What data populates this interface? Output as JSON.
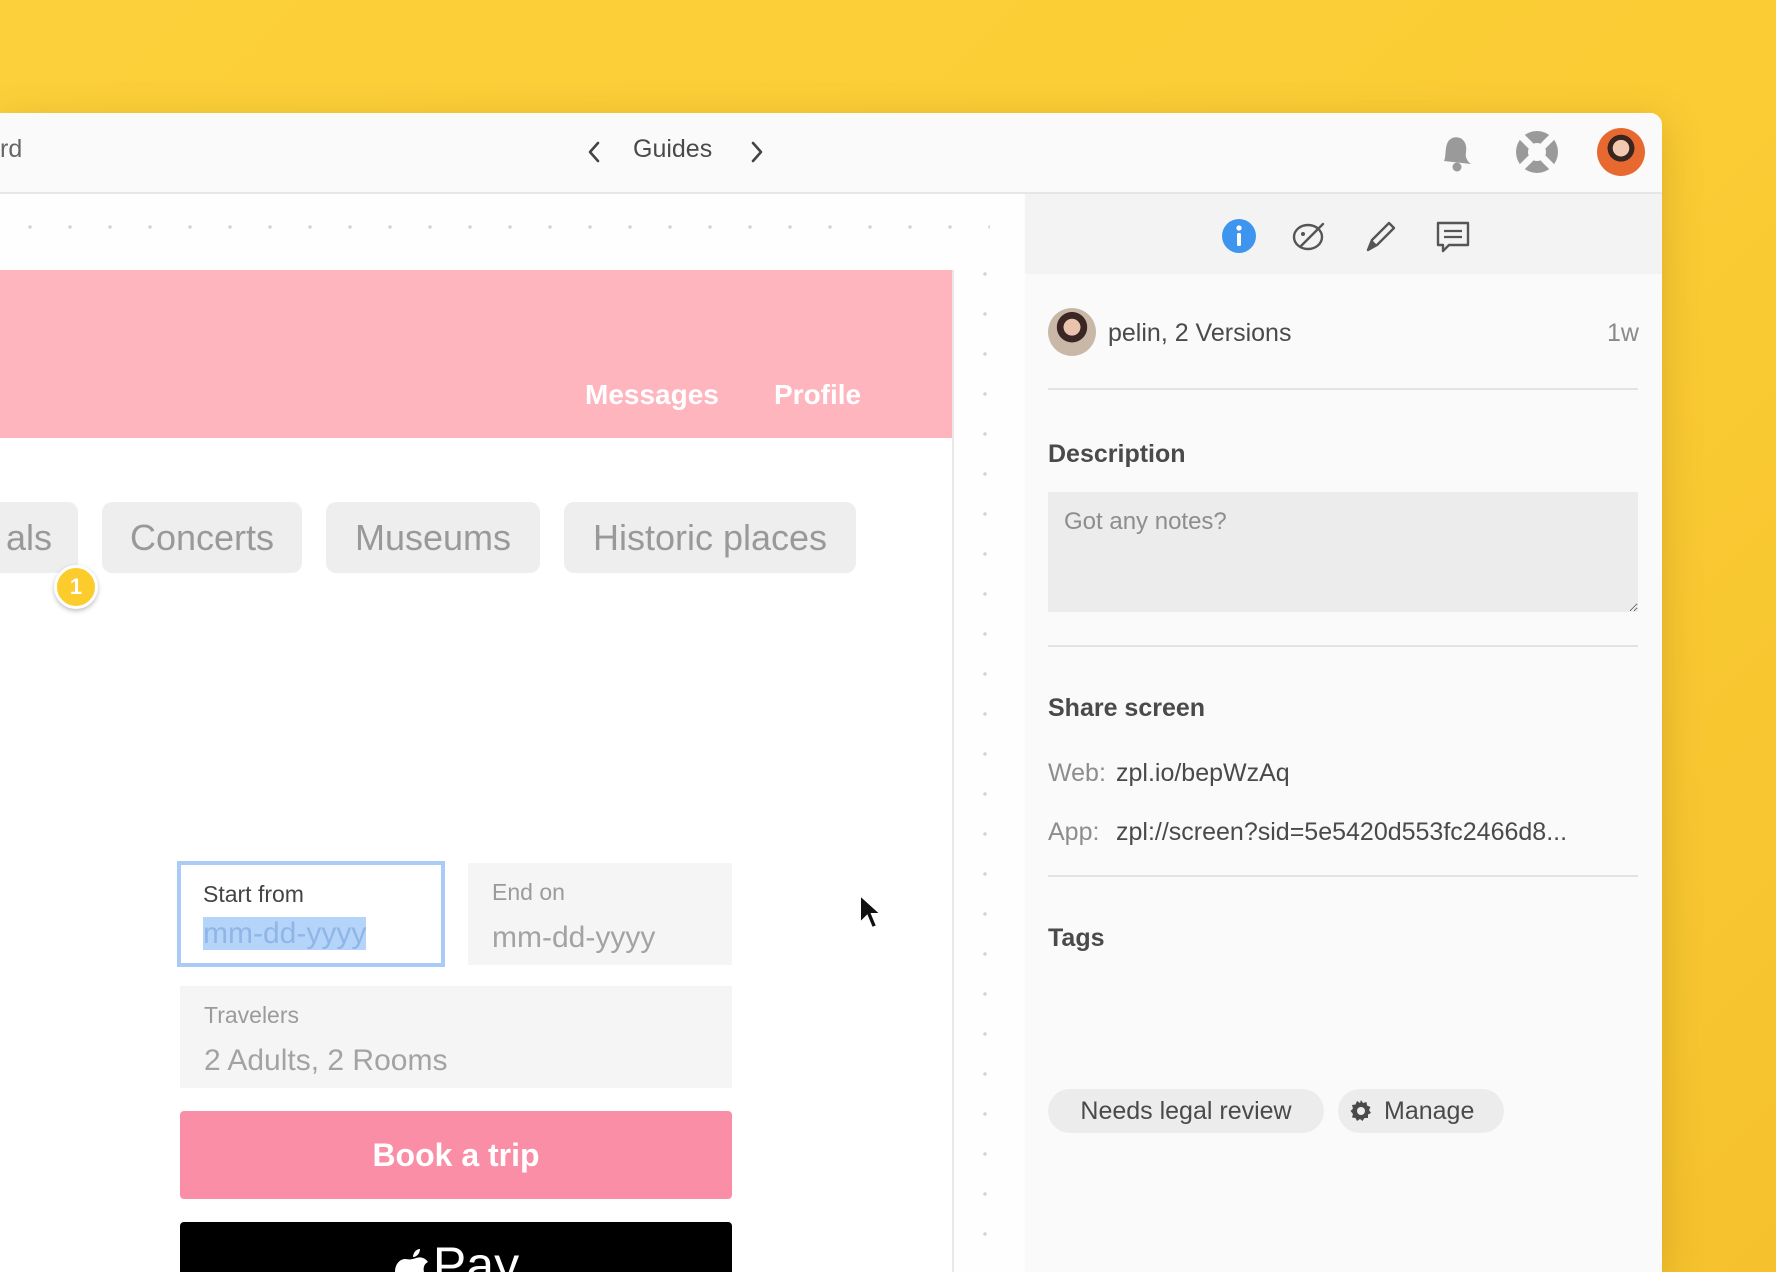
{
  "topbar": {
    "crumb": "rd",
    "nav_title": "Guides",
    "icons": [
      "chevron-left-icon",
      "chevron-right-icon",
      "bell-icon",
      "help-lifebuoy-icon",
      "user-avatar"
    ]
  },
  "prototype": {
    "nav_links": [
      "Messages",
      "Profile"
    ],
    "chips": [
      "als",
      "Concerts",
      "Museums",
      "Historic places"
    ],
    "badge_count": "1",
    "start_label": "Start from",
    "start_value": "mm-dd-yyyy",
    "end_label": "End on",
    "end_value": "mm-dd-yyyy",
    "travelers_label": "Travelers",
    "travelers_value": "2 Adults, 2 Rooms",
    "book_label": "Book a trip",
    "applepay_label": "Pay",
    "colors": {
      "header": "#feb5bd",
      "book_button": "#fa8ea6",
      "badge": "#fccc2d"
    }
  },
  "sidebar": {
    "tabs": [
      "info-icon",
      "style-icon",
      "pen-icon",
      "comment-icon"
    ],
    "author": "pelin, 2 Versions",
    "time": "1w",
    "description_title": "Description",
    "notes_placeholder": "Got any notes?",
    "share_title": "Share screen",
    "web_label": "Web:",
    "web_value": "zpl.io/bepWzAq",
    "app_label": "App:",
    "app_value": "zpl://screen?sid=5e5420d553fc2466d8...",
    "tags_title": "Tags",
    "tags": [
      "Needs legal review"
    ],
    "manage_label": "Manage"
  },
  "colors": {
    "background": "#fcd03a",
    "accent_info": "#3e95ef"
  }
}
